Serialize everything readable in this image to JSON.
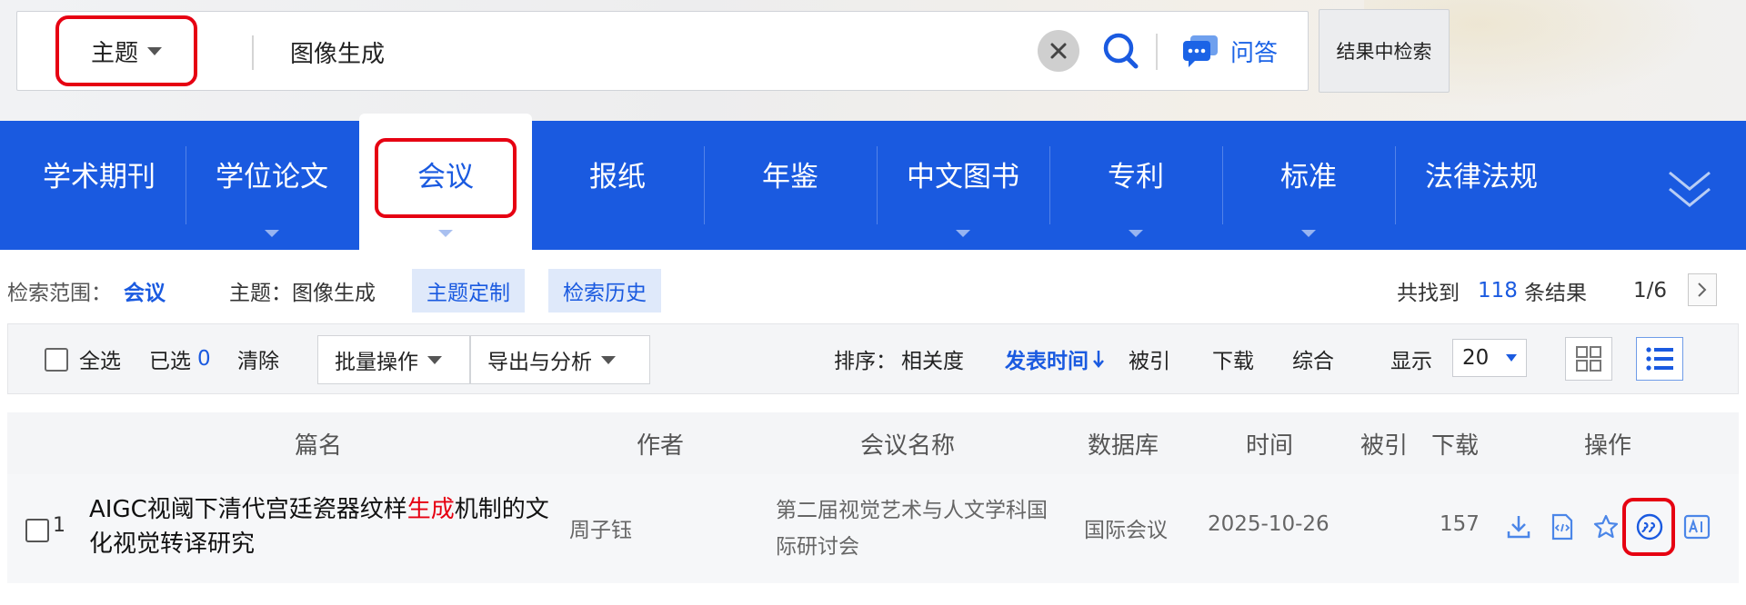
{
  "search": {
    "field": "主题",
    "query": "图像生成",
    "qa_label": "问答",
    "in_result_label": "结果中检索"
  },
  "nav": {
    "items": [
      {
        "label": "学术期刊",
        "active": false,
        "dropdown": false
      },
      {
        "label": "学位论文",
        "active": false,
        "dropdown": true
      },
      {
        "label": "会议",
        "active": true,
        "dropdown": true
      },
      {
        "label": "报纸",
        "active": false,
        "dropdown": false
      },
      {
        "label": "年鉴",
        "active": false,
        "dropdown": false
      },
      {
        "label": "中文图书",
        "active": false,
        "dropdown": true
      },
      {
        "label": "专利",
        "active": false,
        "dropdown": true
      },
      {
        "label": "标准",
        "active": false,
        "dropdown": true
      },
      {
        "label": "法律法规",
        "active": false,
        "dropdown": false
      }
    ],
    "more_icon": "double-chevron-down-icon"
  },
  "scope": {
    "label": "检索范围：",
    "value": "会议",
    "topic": "主题：图像生成",
    "chip_custom": "主题定制",
    "chip_history": "检索历史",
    "found_prefix": "共找到",
    "found_count": "118",
    "found_suffix": "条结果",
    "page": "1/6"
  },
  "toolbar": {
    "select_all": "全选",
    "selected_label": "已选",
    "selected_count": "0",
    "clear": "清除",
    "batch": "批量操作",
    "export": "导出与分析",
    "sort_label": "排序：",
    "sort_options": [
      "相关度",
      "发表时间",
      "被引",
      "下载",
      "综合"
    ],
    "sort_active": "发表时间",
    "show_label": "显示",
    "page_size": "20"
  },
  "table": {
    "headers": [
      "篇名",
      "作者",
      "会议名称",
      "数据库",
      "时间",
      "被引",
      "下载",
      "操作"
    ],
    "rows": [
      {
        "index": "1",
        "title_before": "AIGC视阈下清代宫廷瓷器纹样",
        "title_highlight": "生成",
        "title_after": "机制的文化视觉转译研究",
        "author": "周子钰",
        "conference": "第二届视觉艺术与人文学科国际研讨会",
        "database": "国际会议",
        "date": "2025-10-26",
        "cited": "",
        "downloads": "157",
        "actions": [
          "download-icon",
          "html-read-icon",
          "favorite-star-icon",
          "quote-cite-icon",
          "ai-icon"
        ]
      }
    ]
  },
  "colors": {
    "brand_blue": "#1a5ae0",
    "highlight_red": "#e60012",
    "annotation_red": "#e60012"
  }
}
